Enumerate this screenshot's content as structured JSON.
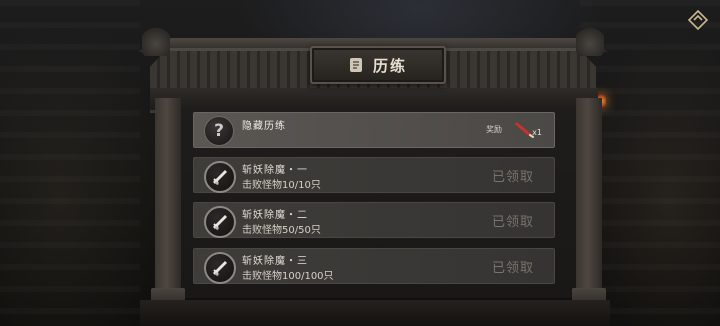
{
  "panel": {
    "title": "历练"
  },
  "hidden_row": {
    "name": "隐藏历练",
    "icon": "question-icon",
    "reward_label": "奖励",
    "reward_count": "x1",
    "reward_icon": "red-brush-icon"
  },
  "quests": [
    {
      "name": "斩妖除魔・一",
      "desc": "击败怪物10/10只",
      "status": "已领取",
      "icon": "sword-icon"
    },
    {
      "name": "斩妖除魔・二",
      "desc": "击败怪物50/50只",
      "status": "已领取",
      "icon": "sword-icon"
    },
    {
      "name": "斩妖除魔・三",
      "desc": "击败怪物100/100只",
      "status": "已领取",
      "icon": "sword-icon"
    }
  ],
  "colors": {
    "title_text": "#e8e0d2",
    "claimed_text": "#77736d",
    "reward_item": "#c8322c"
  }
}
